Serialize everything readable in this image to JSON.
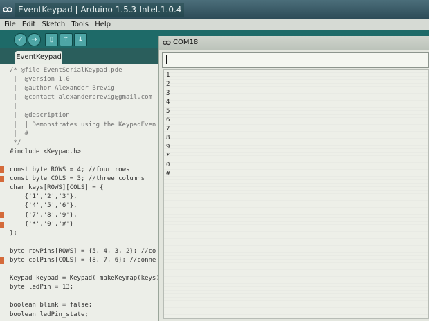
{
  "window": {
    "title": "EventKeypad | Arduino 1.5.3-Intel.1.0.4"
  },
  "menu": [
    "File",
    "Edit",
    "Sketch",
    "Tools",
    "Help"
  ],
  "toolbar": {
    "verify_glyph": "✓",
    "upload_glyph": "→",
    "new_glyph": "▯",
    "open_glyph": "↑",
    "save_glyph": "↓"
  },
  "tab": {
    "label": "EventKeypad"
  },
  "code_lines": [
    "/* @file EventSerialKeypad.pde",
    " || @version 1.0",
    " || @author Alexander Brevig",
    " || @contact alexanderbrevig@gmail.com",
    " ||",
    " || @description",
    " || | Demonstrates using the KeypadEven",
    " || #",
    " */",
    "#include <Keypad.h>",
    "",
    "const byte ROWS = 4; //four rows",
    "const byte COLS = 3; //three columns",
    "char keys[ROWS][COLS] = {",
    "    {'1','2','3'},",
    "    {'4','5','6'},",
    "    {'7','8','9'},",
    "    {'*','0','#'}",
    "};",
    "",
    "byte rowPins[ROWS] = {5, 4, 3, 2}; //co",
    "byte colPins[COLS] = {8, 7, 6}; //conne",
    "",
    "Keypad keypad = Keypad( makeKeymap(keys)",
    "byte ledPin = 13;",
    "",
    "boolean blink = false;",
    "boolean ledPin_state;"
  ],
  "serial_monitor": {
    "title": "COM18",
    "input_value": "",
    "output_lines": [
      "1",
      "2",
      "3",
      "4",
      "5",
      "6",
      "7",
      "8",
      "9",
      "*",
      "0",
      "#"
    ]
  },
  "colors": {
    "toolbar": "#1e6a68",
    "keyword": "#c35a1e",
    "comment": "#6f6f6f"
  }
}
